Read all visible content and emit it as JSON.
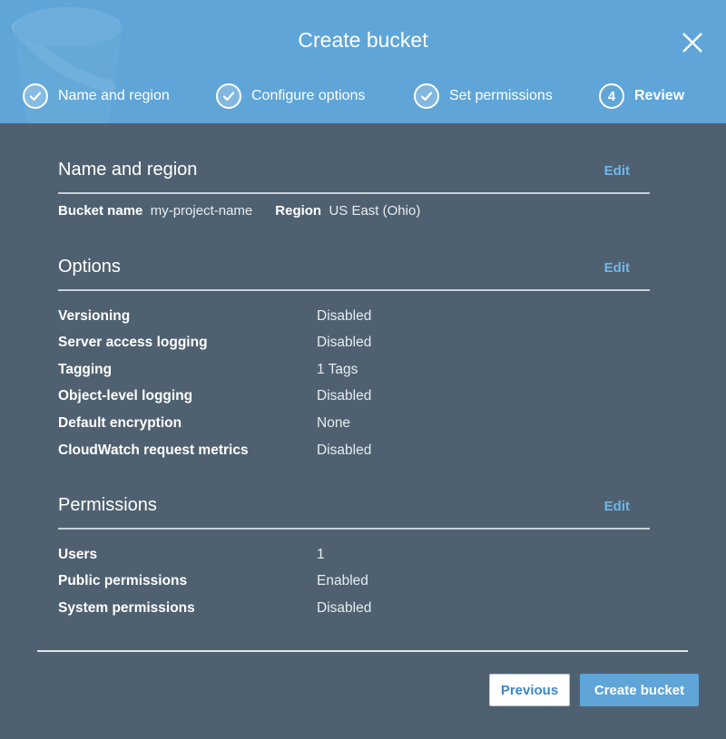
{
  "header": {
    "title": "Create bucket",
    "close_icon": "close-icon"
  },
  "steps": [
    {
      "label": "Name and region",
      "status": "done",
      "icon": "check-icon"
    },
    {
      "label": "Configure options",
      "status": "done",
      "icon": "check-icon"
    },
    {
      "label": "Set permissions",
      "status": "done",
      "icon": "check-icon"
    },
    {
      "label": "Review",
      "number": "4",
      "status": "active"
    }
  ],
  "sections": {
    "name_region": {
      "title": "Name and region",
      "edit": "Edit",
      "bucket_name_label": "Bucket name",
      "bucket_name_value": "my-project-name",
      "region_label": "Region",
      "region_value": "US East (Ohio)"
    },
    "options": {
      "title": "Options",
      "edit": "Edit",
      "rows": [
        {
          "k": "Versioning",
          "v": "Disabled"
        },
        {
          "k": "Server access logging",
          "v": "Disabled"
        },
        {
          "k": "Tagging",
          "v": "1 Tags"
        },
        {
          "k": "Object-level logging",
          "v": "Disabled"
        },
        {
          "k": "Default encryption",
          "v": "None"
        },
        {
          "k": "CloudWatch request metrics",
          "v": "Disabled"
        }
      ]
    },
    "permissions": {
      "title": "Permissions",
      "edit": "Edit",
      "rows": [
        {
          "k": "Users",
          "v": "1"
        },
        {
          "k": "Public permissions",
          "v": "Enabled"
        },
        {
          "k": "System permissions",
          "v": "Disabled"
        }
      ]
    }
  },
  "footer": {
    "previous_label": "Previous",
    "create_label": "Create bucket"
  },
  "colors": {
    "header_bg": "#5fa5d8",
    "body_bg": "#4f6170",
    "link": "#6db7ea",
    "primary_button": "#5fa5d8"
  }
}
